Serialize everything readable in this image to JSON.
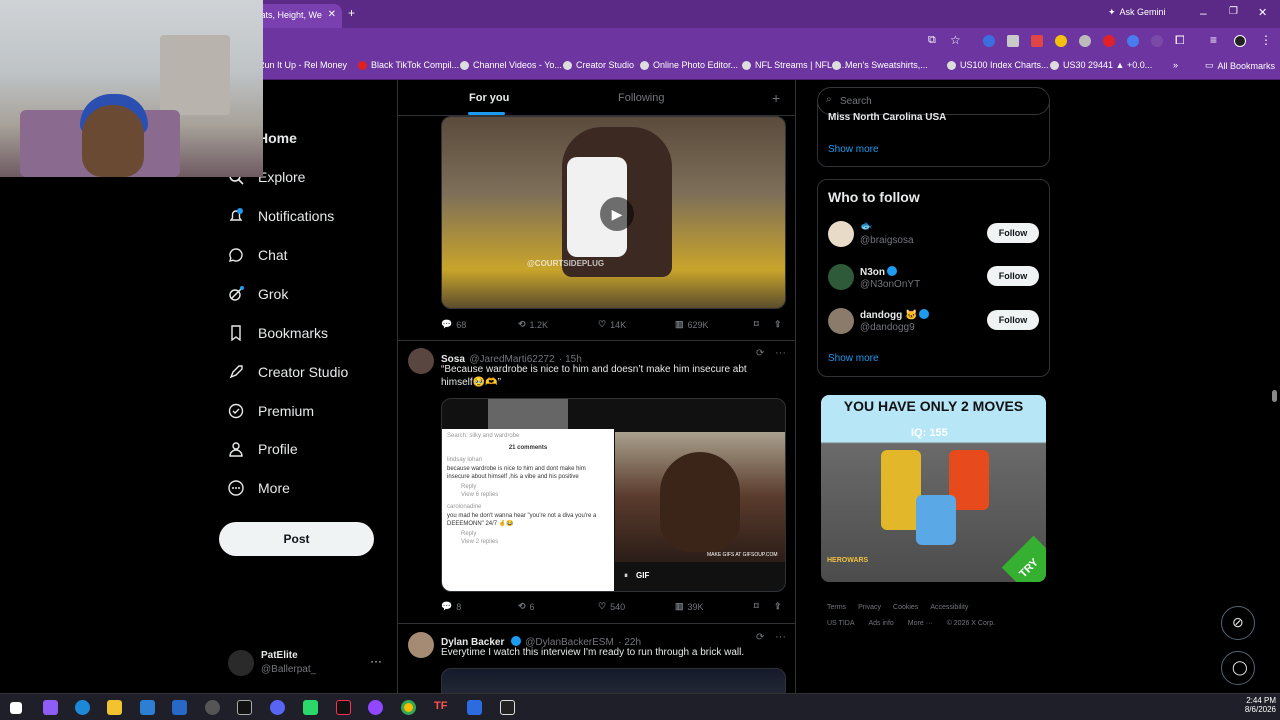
{
  "browser": {
    "tab_title": "tats, Height, We",
    "gemini_label": "Ask Gemini",
    "bookmarks": [
      "Run It Up - Rel Money",
      "Black TikTok Compil...",
      "Channel Videos - Yo...",
      "Creator Studio",
      "Online Photo Editor...",
      "NFL Streams | NFL L...",
      "Men's Sweatshirts,...",
      "US100 Index Charts...",
      "US30 29441 ▲ +0.0..."
    ],
    "all_bookmarks": "All Bookmarks"
  },
  "nav": {
    "items": [
      {
        "label": "Home",
        "icon": "home-icon"
      },
      {
        "label": "Explore",
        "icon": "search-icon"
      },
      {
        "label": "Notifications",
        "icon": "bell-icon",
        "badge": "1"
      },
      {
        "label": "Chat",
        "icon": "chat-icon"
      },
      {
        "label": "Grok",
        "icon": "grok-icon"
      },
      {
        "label": "Bookmarks",
        "icon": "bookmark-icon"
      },
      {
        "label": "Creator Studio",
        "icon": "rocket-icon"
      },
      {
        "label": "Premium",
        "icon": "verified-icon"
      },
      {
        "label": "Profile",
        "icon": "person-icon"
      },
      {
        "label": "More",
        "icon": "more-circle-icon"
      }
    ],
    "post_label": "Post",
    "account": {
      "name": "PatElite",
      "handle": "@Ballerpat_"
    }
  },
  "timeline": {
    "tabs": [
      "For you",
      "Following"
    ],
    "tweet1": {
      "watermark": "@COURTSIDEPLUG",
      "replies": "68",
      "reposts": "1.2K",
      "likes": "14K",
      "views": "629K"
    },
    "tweet2": {
      "name": "Sosa",
      "handle": "@JaredMarti62272",
      "time": "· 15h",
      "text_line1": "“Because wardrobe is nice to him and doesn’t make him insecure abt",
      "text_line2": "himself🥹🫶”",
      "shot_search": "Search: silky and wardrobe",
      "shot_comments": "21 comments",
      "shot_c1_user": "lindsay lohan",
      "shot_c1_text": "because wardrobe is nice to him and dont make him insecure about himself ,his a vibe and his positive",
      "shot_c1_reply": "Reply",
      "shot_c1_view": "View 6 replies",
      "shot_c2_user": "carolonadine",
      "shot_c2_text": "you mad he don't wanna hear \"you're not a diva you're a DEEEMONN\" 24/7 🤞😂",
      "shot_c2_reply": "Reply",
      "shot_c2_view": "View 2 replies",
      "gif_label": "GIF",
      "gif_watermark": "MAKE GIFS AT GIFSOUP.COM",
      "replies": "8",
      "reposts": "6",
      "likes": "540",
      "views": "39K"
    },
    "tweet3": {
      "name": "Dylan Backer",
      "handle": "@DylanBackerESM",
      "time": "· 22h",
      "text": "Everytime I watch this interview I'm ready to run through a brick wall."
    }
  },
  "sidebar": {
    "search_placeholder": "Search",
    "trend_cut": "Miss North Carolina USA",
    "show_more": "Show more",
    "who_to_follow_title": "Who to follow",
    "suggestions": [
      {
        "name": "🐟",
        "handle": "@braigsosa",
        "follow": "Follow"
      },
      {
        "name": "N3on",
        "handle": "@N3onOnYT",
        "follow": "Follow"
      },
      {
        "name": "dandogg 🐱",
        "handle": "@dandogg9",
        "follow": "Follow"
      }
    ],
    "show_more_2": "Show more",
    "ad": {
      "headline": "YOU HAVE ONLY 2 MOVES",
      "iq": "IQ: 155",
      "brand": "HEROWARS",
      "cta": "TRY"
    },
    "footer": {
      "line1": [
        "Terms",
        "Privacy",
        "Cookies",
        "Accessibility"
      ],
      "line2": [
        "US TIDA",
        "Ads info",
        "More ···",
        "© 2026 X Corp."
      ]
    }
  },
  "taskbar": {
    "time": "2:44 PM",
    "date": "8/6/2026"
  },
  "colors": {
    "accent": "#1d9bf0",
    "chrome": "#6d35a0",
    "bg": "#000000"
  }
}
